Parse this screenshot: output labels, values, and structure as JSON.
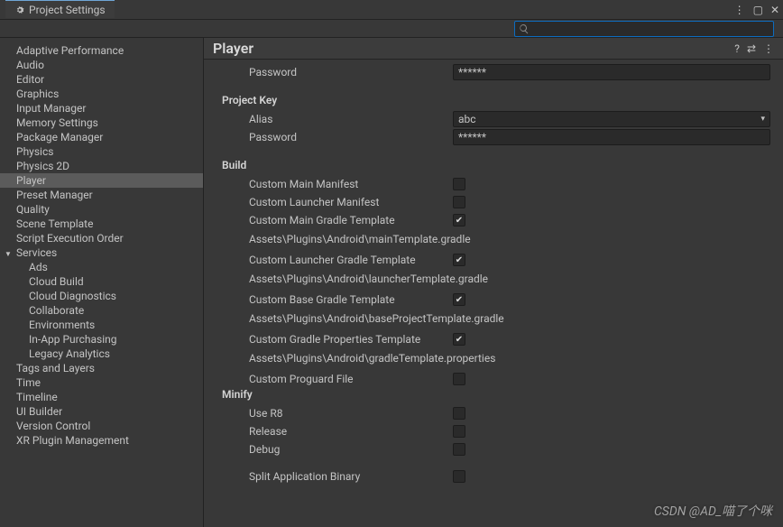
{
  "window": {
    "title": "Project Settings"
  },
  "search": {
    "placeholder": ""
  },
  "sidebar": {
    "items": [
      {
        "label": "Adaptive Performance"
      },
      {
        "label": "Audio"
      },
      {
        "label": "Editor"
      },
      {
        "label": "Graphics"
      },
      {
        "label": "Input Manager"
      },
      {
        "label": "Memory Settings"
      },
      {
        "label": "Package Manager"
      },
      {
        "label": "Physics"
      },
      {
        "label": "Physics 2D"
      },
      {
        "label": "Player",
        "selected": true
      },
      {
        "label": "Preset Manager"
      },
      {
        "label": "Quality"
      },
      {
        "label": "Scene Template"
      },
      {
        "label": "Script Execution Order"
      },
      {
        "label": "Services",
        "expandable": true,
        "expanded": true,
        "children": [
          {
            "label": "Ads"
          },
          {
            "label": "Cloud Build"
          },
          {
            "label": "Cloud Diagnostics"
          },
          {
            "label": "Collaborate"
          },
          {
            "label": "Environments"
          },
          {
            "label": "In-App Purchasing"
          },
          {
            "label": "Legacy Analytics"
          }
        ]
      },
      {
        "label": "Tags and Layers"
      },
      {
        "label": "Time"
      },
      {
        "label": "Timeline"
      },
      {
        "label": "UI Builder"
      },
      {
        "label": "Version Control"
      },
      {
        "label": "XR Plugin Management"
      }
    ]
  },
  "page": {
    "title": "Player",
    "keystore": {
      "password_label": "Password",
      "password_value": "******"
    },
    "project_key": {
      "heading": "Project Key",
      "alias_label": "Alias",
      "alias_value": "abc",
      "password_label": "Password",
      "password_value": "******"
    },
    "build": {
      "heading": "Build",
      "rows": [
        {
          "label": "Custom Main Manifest",
          "checked": false
        },
        {
          "label": "Custom Launcher Manifest",
          "checked": false
        },
        {
          "label": "Custom Main Gradle Template",
          "checked": true,
          "path": "Assets\\Plugins\\Android\\mainTemplate.gradle"
        },
        {
          "label": "Custom Launcher Gradle Template",
          "checked": true,
          "path": "Assets\\Plugins\\Android\\launcherTemplate.gradle"
        },
        {
          "label": "Custom Base Gradle Template",
          "checked": true,
          "path": "Assets\\Plugins\\Android\\baseProjectTemplate.gradle"
        },
        {
          "label": "Custom Gradle Properties Template",
          "checked": true,
          "path": "Assets\\Plugins\\Android\\gradleTemplate.properties"
        },
        {
          "label": "Custom Proguard File",
          "checked": false
        }
      ]
    },
    "minify": {
      "heading": "Minify",
      "rows": [
        {
          "label": "Use R8",
          "checked": false
        },
        {
          "label": "Release",
          "checked": false
        },
        {
          "label": "Debug",
          "checked": false
        }
      ]
    },
    "split_binary": {
      "label": "Split Application Binary",
      "checked": false
    }
  },
  "watermark": "CSDN @AD_喵了个咪"
}
